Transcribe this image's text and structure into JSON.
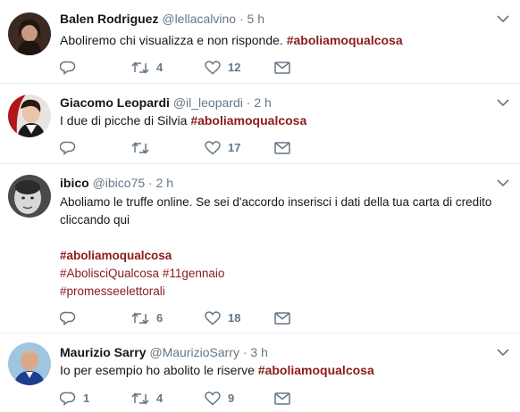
{
  "tweets": [
    {
      "name": "Balen Rodriguez",
      "handle": "@lellacalvino",
      "sep": "·",
      "time": "5 h",
      "text_parts": [
        "Aboliremo chi visualizza e non risponde.  "
      ],
      "hashtags": [
        "#aboliamoqualcosa"
      ],
      "replies": "",
      "retweets": "4",
      "likes": "12",
      "avatar": "woman-dark-hair-avatar"
    },
    {
      "name": "Giacomo Leopardi",
      "handle": "@il_leopardi",
      "sep": "·",
      "time": "2 h",
      "text_parts": [
        "I due di picche di Silvia "
      ],
      "hashtags": [
        "#aboliamoqualcosa"
      ],
      "replies": "",
      "retweets": "",
      "likes": "17",
      "avatar": "portrait-red-avatar"
    },
    {
      "name": "ibico",
      "handle": "@ibico75",
      "sep": "·",
      "time": "2 h",
      "text_lines": [
        "Aboliamo le truffe online. Se sei d'accordo inserisci i dati della tua carta di credito",
        "cliccando qui"
      ],
      "hashtag_main": "#aboliamoqualcosa",
      "hashtags_line2": [
        "#AbolisciQualcosa",
        "#11gennaio"
      ],
      "hashtag_line3": "#promesseelettorali",
      "replies": "",
      "retweets": "6",
      "likes": "18",
      "avatar": "bw-face-avatar"
    },
    {
      "name": "Maurizio Sarry",
      "handle": "@MaurizioSarry",
      "sep": "·",
      "time": "3 h",
      "text_parts": [
        "Io per esempio ho abolito le riserve "
      ],
      "hashtags": [
        "#aboliamoqualcosa"
      ],
      "replies": "1",
      "retweets": "4",
      "likes": "9",
      "avatar": "man-blue-jacket-avatar"
    }
  ],
  "colors": {
    "hashtag": "#8b1a1a",
    "muted": "#657786",
    "divider": "#e6ecf0"
  },
  "icons": {
    "reply": "reply-icon",
    "retweet": "retweet-icon",
    "like": "heart-icon",
    "message": "envelope-icon",
    "menu": "chevron-down-icon"
  }
}
